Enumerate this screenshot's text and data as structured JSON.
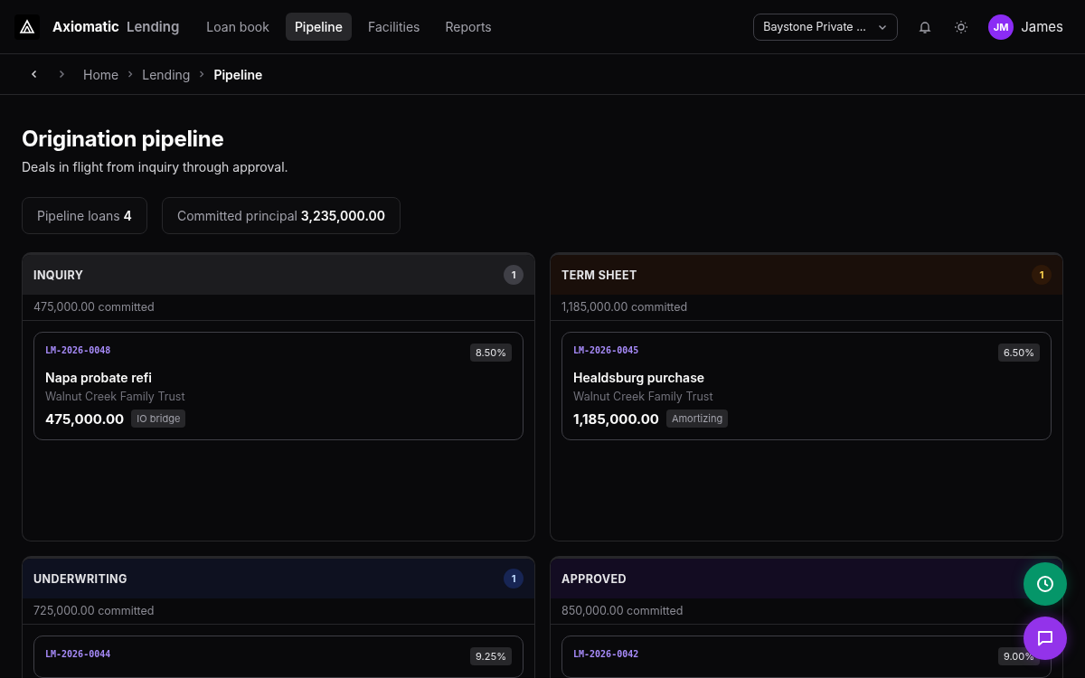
{
  "nav": {
    "brand": "Axiomatic",
    "brand_suffix": "Lending",
    "links": [
      {
        "label": "Loan book",
        "selected": false
      },
      {
        "label": "Pipeline",
        "selected": true
      },
      {
        "label": "Facilities",
        "selected": false
      },
      {
        "label": "Reports",
        "selected": false
      }
    ],
    "org_select": {
      "value": "Baystone Private ..."
    },
    "user": {
      "initials": "JM",
      "name": "James"
    }
  },
  "breadcrumb": {
    "items": [
      {
        "label": "Home",
        "current": false
      },
      {
        "label": "Lending",
        "current": false
      },
      {
        "label": "Pipeline",
        "current": true
      }
    ]
  },
  "page": {
    "title": "Origination pipeline",
    "subtitle": "Deals in flight from inquiry through approval."
  },
  "stats": [
    {
      "label": "Pipeline loans",
      "value": "4"
    },
    {
      "label": "Committed principal",
      "value": "3,235,000.00"
    }
  ],
  "columns": [
    {
      "title": "INQUIRY",
      "count": "1",
      "kind": "inquiry",
      "committed": "475,000.00 committed",
      "loans": [
        {
          "id": "LM-2026-0048",
          "rate": "8.50%",
          "name": "Napa probate refi",
          "borrower": "Walnut Creek Family Trust",
          "amount": "475,000.00",
          "type": "IO bridge"
        }
      ]
    },
    {
      "title": "TERM SHEET",
      "count": "1",
      "kind": "terms",
      "committed": "1,185,000.00 committed",
      "loans": [
        {
          "id": "LM-2026-0045",
          "rate": "6.50%",
          "name": "Healdsburg purchase",
          "borrower": "Walnut Creek Family Trust",
          "amount": "1,185,000.00",
          "type": "Amortizing"
        }
      ]
    },
    {
      "title": "UNDERWRITING",
      "count": "1",
      "kind": "underwriting",
      "committed": "725,000.00 committed",
      "loans": [
        {
          "id": "LM-2026-0044",
          "rate": "9.25%"
        }
      ]
    },
    {
      "title": "APPROVED",
      "kind": "approved",
      "committed": "850,000.00 committed",
      "loans": [
        {
          "id": "LM-2026-0042",
          "rate": "9.00%"
        }
      ]
    }
  ]
}
